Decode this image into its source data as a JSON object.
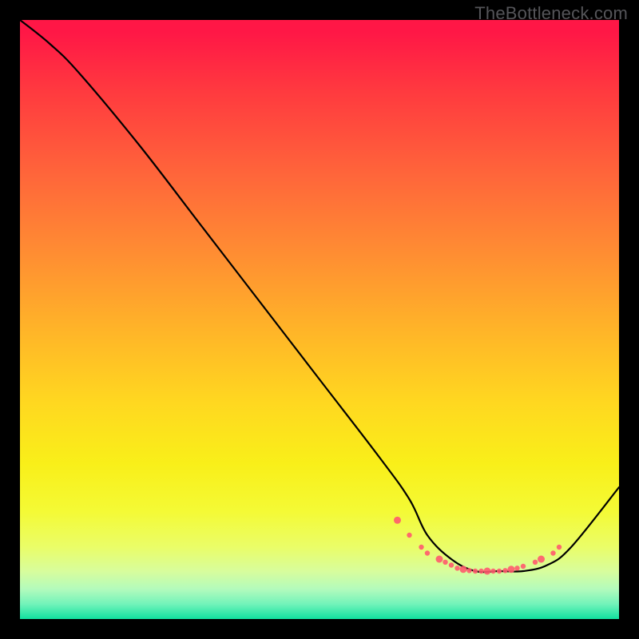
{
  "watermark": "TheBottleneck.com",
  "chart_data": {
    "type": "line",
    "title": "",
    "xlabel": "",
    "ylabel": "",
    "xlim": [
      0,
      100
    ],
    "ylim": [
      0,
      100
    ],
    "grid": false,
    "series": [
      {
        "name": "curve",
        "x": [
          0,
          5,
          10,
          20,
          30,
          40,
          50,
          60,
          65,
          68,
          72,
          76,
          80,
          84,
          88,
          92,
          100
        ],
        "values": [
          100,
          96,
          91,
          79,
          66,
          53,
          40,
          27,
          20,
          14,
          10,
          8,
          8,
          8,
          9,
          12,
          22
        ]
      }
    ],
    "markers": {
      "name": "highlight-dots",
      "color": "#ff5a6e",
      "x": [
        63,
        65,
        67,
        68,
        70,
        71,
        72,
        73,
        74,
        75,
        76,
        77,
        78,
        79,
        80,
        81,
        82,
        83,
        84,
        86,
        87,
        89,
        90
      ],
      "values": [
        16.5,
        14,
        12,
        11,
        10,
        9.5,
        9,
        8.5,
        8.3,
        8.1,
        8,
        8,
        8,
        8,
        8,
        8.1,
        8.3,
        8.5,
        8.8,
        9.5,
        10,
        11,
        12
      ]
    },
    "gradient_stops": [
      {
        "pos": 0,
        "color": "#ff1746"
      },
      {
        "pos": 0.5,
        "color": "#ffd820"
      },
      {
        "pos": 0.82,
        "color": "#f4fa35"
      },
      {
        "pos": 1.0,
        "color": "#11e19f"
      }
    ]
  }
}
